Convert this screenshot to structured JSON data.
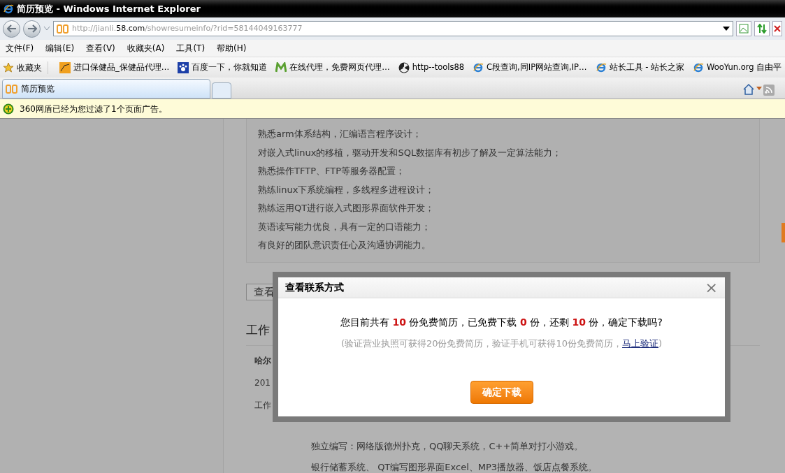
{
  "window": {
    "title": "简历预览 - Windows Internet Explorer"
  },
  "address_bar": {
    "prefix": "http://jianli.",
    "domain": "58.com",
    "suffix": "/showresumeinfo/?rid=58144049163777"
  },
  "menu": [
    "文件(F)",
    "编辑(E)",
    "查看(V)",
    "收藏夹(A)",
    "工具(T)",
    "帮助(H)"
  ],
  "favorites_button": "收藏夹",
  "favorites": [
    {
      "kind": "orange",
      "label": "进口保健品_保健品代理…"
    },
    {
      "kind": "paw",
      "label": "百度一下，你就知道"
    },
    {
      "kind": "m",
      "label": "在线代理，免费网页代理…"
    },
    {
      "kind": "radiation",
      "label": "http--tools88"
    },
    {
      "kind": "ie",
      "label": "C段查询,同IP网站查询,IP…"
    },
    {
      "kind": "ie",
      "label": "站长工具 - 站长之家"
    },
    {
      "kind": "ie",
      "label": "WooYun.org  自由平"
    }
  ],
  "tabs": [
    {
      "label": "简历预览",
      "selected": true
    }
  ],
  "info_bar": "360网盾已经为您过滤了1个页面广告。",
  "skills": [
    "熟悉arm体系结构，汇编语言程序设计；",
    "对嵌入式linux的移植，驱动开发和SQL数据库有初步了解及一定算法能力；",
    "熟悉操作TFTP、FTP等服务器配置；",
    "熟练linux下系统编程，多线程多进程设计；",
    "熟练运用QT进行嵌入式图形界面软件开发；",
    "英语读写能力优良，具有一定的口语能力；",
    "有良好的团队意识责任心及沟通协调能力。"
  ],
  "view_button": "查看",
  "section_heading": "工作",
  "job": {
    "company": "哈尔",
    "date": "201",
    "label": "工作"
  },
  "projects": [
    "独立编写：网络版德州扑克，QQ聊天系统，C++简单对打小游戏。",
    "银行储蓄系统、 QT编写图形界面Excel、MP3播放器、饭店点餐系统。"
  ],
  "dialog": {
    "title": "查看联系方式",
    "close": "×",
    "message": "您目前共有 **10** 份免费简历，已免费下载 **0** 份，还剩 **10** 份，确定下载吗?",
    "hint_before": "(验证营业执照可获得20份免费简历，验证手机可获得10份免费简历，",
    "hint_link": "马上验证",
    "hint_after": ")",
    "confirm": "确定下载"
  }
}
